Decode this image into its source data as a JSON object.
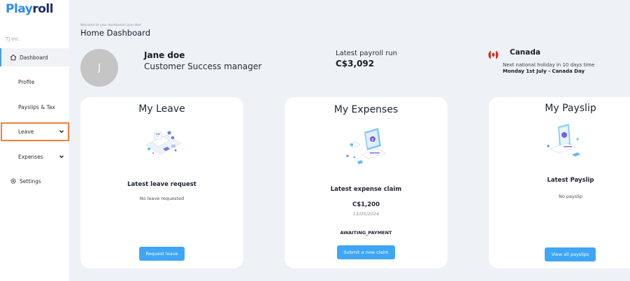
{
  "app": {
    "logo_part1": "Play",
    "logo_part2": "roll",
    "org_name": "TJ Inc"
  },
  "sidebar": {
    "items": [
      {
        "label": "Dashboard",
        "icon": "home-icon",
        "active": true
      },
      {
        "label": "Profile"
      },
      {
        "label": "Payslips & Tax"
      },
      {
        "label": "Leave",
        "icon": "chevron-down-icon",
        "highlighted": true
      },
      {
        "label": "Expenses",
        "icon": "chevron-down-icon"
      },
      {
        "label": "Settings",
        "icon": "gear-icon"
      }
    ]
  },
  "header": {
    "welcome": "Welcome to your dashboard, Jane doe!",
    "title": "Home Dashboard"
  },
  "user": {
    "avatar_initial": "J",
    "name": "Jane doe",
    "role": "Customer Success manager"
  },
  "payroll": {
    "label": "Latest payroll run",
    "amount": "C$3,092",
    "sub": "-"
  },
  "country": {
    "name": "Canada",
    "flag_icon": "canada-flag-icon",
    "holiday_line1": "Next national holiday in 10 days time",
    "holiday_line2": "Monday 1st July - Canada Day"
  },
  "cards": {
    "leave": {
      "title": "My Leave",
      "subtitle": "Latest leave request",
      "note": "No leave requested",
      "button": "Request leave"
    },
    "expenses": {
      "title": "My Expenses",
      "subtitle": "Latest expense claim",
      "amount": "C$1,200",
      "date": "13/05/2024",
      "status": "AWAITING_PAYMENT",
      "button": "Submit a new claim"
    },
    "payslip": {
      "title": "My Payslip",
      "subtitle": "Latest Payslip",
      "note": "No payslip",
      "button": "View all payslips"
    }
  },
  "colors": {
    "accent": "#3ea6f5",
    "brand_blue": "#2a8cf3",
    "brand_navy": "#1d2b6e",
    "highlight_outline": "#f07f3a",
    "background": "#eef1f6"
  }
}
